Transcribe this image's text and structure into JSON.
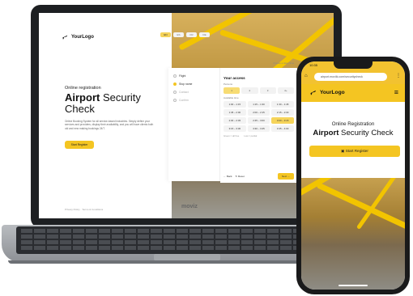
{
  "laptop": {
    "logo": "YourLogo",
    "nav": [
      "EN",
      "ES",
      "FR",
      "DE"
    ],
    "subtitle": "Online registration",
    "title_bold": "Airport",
    "title_rest": " Security Check",
    "description": "Online Booking System for all service-based industries. Simply define your services and providers, display their availability, and you will have clients both old and new making bookings 24/7.",
    "start_button": "Start Register",
    "footer": "Privacy Policy · Terms & Conditions",
    "brand": "moviz",
    "steps": [
      {
        "label": "Flight",
        "state": "done"
      },
      {
        "label": "Stop name",
        "state": "active"
      },
      {
        "label": "Contact",
        "state": "pending"
      },
      {
        "label": "Confirm",
        "state": "pending"
      }
    ],
    "panel": {
      "note": "Choose a date / time",
      "heading": "Your access",
      "persons_label": "Persons",
      "persons": [
        "1",
        "2",
        "3",
        "4+"
      ],
      "persons_selected": 0,
      "slots_label": "Available time",
      "slots": [
        "1:00 – 1:15",
        "1:15 – 1:30",
        "1:30 – 1:45",
        "1:45 – 2:00",
        "2:00 – 2:15",
        "2:15 – 2:30",
        "2:30 – 2:45",
        "2:45 – 3:00",
        "3:00 – 3:15",
        "3:15 – 3:30",
        "3:30 – 3:45",
        "3:45 – 4:00"
      ],
      "slots_selected": 8,
      "legend": [
        "Green = all free",
        "Low = partial"
      ],
      "back": "Back",
      "reset": "Reset",
      "next": "Next"
    }
  },
  "phone": {
    "time": "10:35",
    "url": "airport.moviik.com/securitycheck",
    "logo": "YourLogo",
    "subtitle": "Online Registration",
    "title_bold": "Airport",
    "title_rest": " Security Check",
    "start_button": "Start Register"
  },
  "colors": {
    "accent": "#f4c522",
    "dark": "#1d1f22"
  }
}
